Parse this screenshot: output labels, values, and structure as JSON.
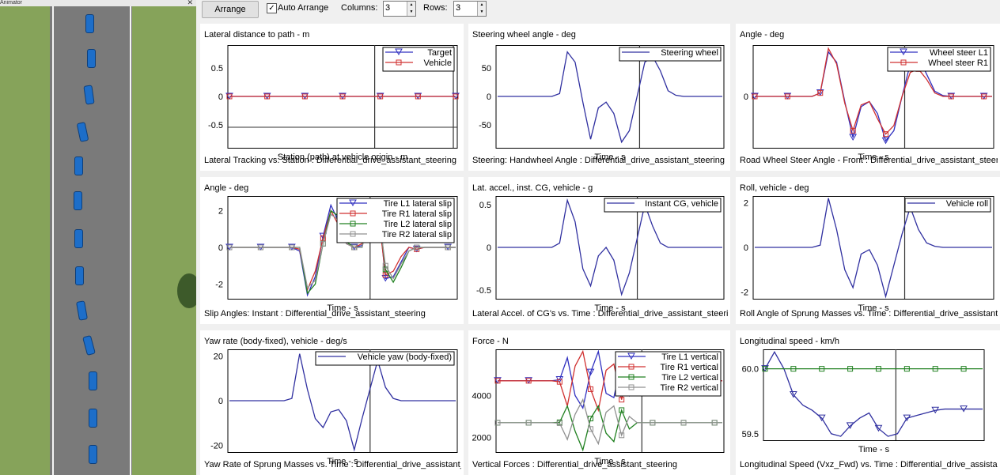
{
  "animator": {
    "title": "Animator"
  },
  "toolbar": {
    "arrange_label": "Arrange",
    "auto_arrange_checked": true,
    "auto_arrange_label": "Auto Arrange",
    "columns_label": "Columns:",
    "columns_value": "3",
    "rows_label": "Rows:",
    "rows_value": "3"
  },
  "plots": [
    {
      "title": "Lateral distance to path - m",
      "xlabel": "Station (path) at vehicle origin - m",
      "caption": "Lateral Tracking vs. Station : Differential_drive_assistant_steering"
    },
    {
      "title": "Steering wheel angle - deg",
      "xlabel": "Time - s",
      "caption": "Steering: Handwheel Angle : Differential_drive_assistant_steering"
    },
    {
      "title": "Angle - deg",
      "xlabel": "Time - s",
      "caption": "Road Wheel Steer Angle - Front : Differential_drive_assistant_steering"
    },
    {
      "title": "Angle - deg",
      "xlabel": "Time - s",
      "caption": "Slip Angles: Instant : Differential_drive_assistant_steering"
    },
    {
      "title": "Lat. accel., inst. CG, vehicle - g",
      "xlabel": "Time - s",
      "caption": "Lateral Accel. of CG's vs. Time : Differential_drive_assistant_steering"
    },
    {
      "title": "Roll, vehicle - deg",
      "xlabel": "Time - s",
      "caption": "Roll Angle of Sprung Masses vs. Time : Differential_drive_assistant_steering"
    },
    {
      "title": "Yaw rate (body-fixed), vehicle - deg/s",
      "xlabel": "Time - s",
      "caption": "Yaw Rate of Sprung Masses vs. Time : Differential_drive_assistant_steering"
    },
    {
      "title": "Force - N",
      "xlabel": "Time - s",
      "caption": "Vertical Forces : Differential_drive_assistant_steering"
    },
    {
      "title": "Longitudinal speed - km/h",
      "xlabel": "Time - s",
      "caption": "Longitudinal Speed (Vxz_Fwd) vs. Time : Differential_drive_assistant_steering"
    }
  ],
  "chart_data": [
    {
      "type": "line",
      "ylim": [
        -0.9,
        0.9
      ],
      "yticks": [
        "0.5",
        "0",
        "-0.5"
      ],
      "legend": "top-right",
      "series": [
        {
          "name": "Target",
          "color": "#3030c0",
          "marker": "triangle-down",
          "values": [
            0,
            0,
            0,
            0,
            0,
            0,
            0
          ]
        },
        {
          "name": "Vehicle",
          "color": "#d03030",
          "marker": "square",
          "values": [
            0,
            0,
            0,
            0,
            0,
            0,
            0
          ]
        }
      ]
    },
    {
      "type": "line",
      "ylim": [
        -90,
        90
      ],
      "yticks": [
        "50",
        "0",
        "-50"
      ],
      "legend": "top-right",
      "series": [
        {
          "name": "Steering wheel",
          "color": "#3030a0",
          "values": [
            0,
            0,
            0,
            0,
            0,
            0,
            0,
            0,
            5,
            78,
            60,
            -10,
            -75,
            -20,
            -10,
            -30,
            -80,
            -60,
            0,
            60,
            70,
            45,
            10,
            2,
            0,
            0,
            0,
            0,
            0,
            0
          ]
        }
      ]
    },
    {
      "type": "line",
      "ylim": [
        -3,
        3
      ],
      "yticks": [
        "0"
      ],
      "legend": "top-right",
      "series": [
        {
          "name": "Wheel steer L1",
          "color": "#3030c0",
          "marker": "triangle-down",
          "values": [
            0,
            0,
            0,
            0,
            0,
            0,
            0,
            0,
            0.2,
            2.6,
            2.0,
            -0.3,
            -2.4,
            -0.6,
            -0.3,
            -1.0,
            -2.6,
            -2.0,
            0,
            1.9,
            2.3,
            1.3,
            0.3,
            0.05,
            0,
            0,
            0,
            0,
            0,
            0
          ]
        },
        {
          "name": "Wheel steer R1",
          "color": "#d03030",
          "marker": "square",
          "values": [
            0,
            0,
            0,
            0,
            0,
            0,
            0,
            0,
            0.2,
            2.8,
            1.9,
            -0.4,
            -2.0,
            -0.5,
            -0.3,
            -1.3,
            -2.2,
            -1.7,
            0,
            1.4,
            1.6,
            1.0,
            0.2,
            0,
            0,
            0,
            0,
            0,
            0,
            0
          ]
        }
      ]
    },
    {
      "type": "line",
      "ylim": [
        -2.8,
        2.8
      ],
      "yticks": [
        "2",
        "0",
        "-2"
      ],
      "legend": "top-right",
      "series": [
        {
          "name": "Tire L1 lateral slip",
          "color": "#3030c0",
          "marker": "triangle-down",
          "values": [
            0,
            0,
            0,
            0,
            0,
            0,
            0,
            0,
            0,
            -0.2,
            -2.6,
            -1.6,
            0.6,
            2.3,
            1.4,
            0.2,
            0,
            0.1,
            2.4,
            2.6,
            -1.7,
            -1.6,
            -0.8,
            0,
            -0.1,
            0,
            0,
            0,
            0,
            0
          ]
        },
        {
          "name": "Tire R1 lateral slip",
          "color": "#d03030",
          "marker": "square",
          "values": [
            0,
            0,
            0,
            0,
            0,
            0,
            0,
            0,
            0,
            -0.1,
            -2.3,
            -1.3,
            0.5,
            2.0,
            1.2,
            0.2,
            0,
            0.2,
            2.1,
            2.2,
            -1.5,
            -1.3,
            -0.5,
            0,
            -0.1,
            0,
            0,
            0,
            0,
            0
          ]
        },
        {
          "name": "Tire L2 lateral slip",
          "color": "#208020",
          "marker": "square",
          "values": [
            0,
            0,
            0,
            0,
            0,
            0,
            0,
            0,
            0,
            0,
            -2.5,
            -2.0,
            0.2,
            2.0,
            1.7,
            0.3,
            0,
            0,
            2.0,
            2.5,
            -1.2,
            -1.9,
            -1.1,
            -0.2,
            0,
            0,
            0,
            0,
            0,
            0
          ]
        },
        {
          "name": "Tire R2 lateral slip",
          "color": "#909090",
          "marker": "square",
          "values": [
            0,
            0,
            0,
            0,
            0,
            0,
            0,
            0,
            0,
            0,
            -2.2,
            -1.8,
            0.2,
            1.8,
            1.5,
            0.2,
            0,
            0,
            1.8,
            2.2,
            -1.0,
            -1.7,
            -0.9,
            -0.2,
            0,
            0,
            0,
            0,
            0,
            0
          ]
        }
      ]
    },
    {
      "type": "line",
      "ylim": [
        -0.6,
        0.6
      ],
      "yticks": [
        "0.5",
        "0",
        "-0.5"
      ],
      "legend": "top-right",
      "series": [
        {
          "name": "Instant CG, vehicle",
          "color": "#3030a0",
          "values": [
            0,
            0,
            0,
            0,
            0,
            0,
            0,
            0,
            0.05,
            0.55,
            0.3,
            -0.25,
            -0.45,
            -0.1,
            0,
            -0.15,
            -0.55,
            -0.3,
            0.1,
            0.5,
            0.25,
            0.05,
            0,
            0,
            0,
            0,
            0,
            0,
            0,
            0
          ]
        }
      ]
    },
    {
      "type": "line",
      "ylim": [
        -2.3,
        2.3
      ],
      "yticks": [
        "2",
        "0",
        "-2"
      ],
      "legend": "top-right",
      "series": [
        {
          "name": "Vehicle roll",
          "color": "#3030a0",
          "values": [
            0,
            0,
            0,
            0,
            0,
            0,
            0,
            0,
            0.1,
            2.2,
            0.8,
            -1.0,
            -1.8,
            -0.3,
            -0.1,
            -0.8,
            -2.2,
            -0.8,
            0.6,
            1.8,
            0.8,
            0.2,
            0.05,
            0,
            0,
            0,
            0,
            0,
            0,
            0
          ]
        }
      ]
    },
    {
      "type": "line",
      "ylim": [
        -23,
        23
      ],
      "yticks": [
        "20",
        "0",
        "-20"
      ],
      "legend": "top-right",
      "series": [
        {
          "name": "Vehicle yaw (body-fixed)",
          "color": "#3030a0",
          "values": [
            0,
            0,
            0,
            0,
            0,
            0,
            0,
            0,
            1,
            21,
            5,
            -8,
            -12,
            -5,
            -4,
            -9,
            -22,
            -8,
            5,
            18,
            6,
            1,
            0,
            0,
            0,
            0,
            0,
            0,
            0,
            0
          ]
        }
      ]
    },
    {
      "type": "line",
      "ylim": [
        1300,
        6200
      ],
      "yticks": [
        "4000",
        "2000"
      ],
      "legend": "top-right",
      "series": [
        {
          "name": "Tire L1 vertical",
          "color": "#3030c0",
          "marker": "triangle-down",
          "values": [
            4700,
            4700,
            4700,
            4700,
            4700,
            4700,
            4700,
            4700,
            4750,
            5800,
            4000,
            3400,
            5100,
            6100,
            4100,
            3900,
            5600,
            4000,
            4700,
            4700,
            4700,
            4700,
            4700,
            4700,
            4700,
            4700,
            4700,
            4700,
            4700,
            4700
          ]
        },
        {
          "name": "Tire R1 vertical",
          "color": "#d03030",
          "marker": "square",
          "values": [
            4700,
            4700,
            4700,
            4700,
            4700,
            4700,
            4700,
            4700,
            4650,
            3500,
            5400,
            6100,
            4300,
            3300,
            5200,
            5500,
            3800,
            5400,
            4700,
            4700,
            4700,
            4700,
            4700,
            4700,
            4700,
            4700,
            4700,
            4700,
            4700,
            4700
          ]
        },
        {
          "name": "Tire L2 vertical",
          "color": "#208020",
          "marker": "square",
          "values": [
            2700,
            2700,
            2700,
            2700,
            2700,
            2700,
            2700,
            2700,
            2720,
            3500,
            2300,
            1400,
            2900,
            3500,
            2200,
            1800,
            3300,
            2400,
            2700,
            2700,
            2700,
            2700,
            2700,
            2700,
            2700,
            2700,
            2700,
            2700,
            2700,
            2700
          ]
        },
        {
          "name": "Tire R2 vertical",
          "color": "#909090",
          "marker": "square",
          "values": [
            2700,
            2700,
            2700,
            2700,
            2700,
            2700,
            2700,
            2700,
            2680,
            1900,
            3100,
            3800,
            2400,
            1700,
            3200,
            3500,
            2100,
            3000,
            2700,
            2700,
            2700,
            2700,
            2700,
            2700,
            2700,
            2700,
            2700,
            2700,
            2700,
            2700
          ]
        }
      ]
    },
    {
      "type": "line",
      "ylim": [
        59.45,
        60.15
      ],
      "yticks": [
        "60.0",
        "59.5"
      ],
      "legend": "none",
      "series": [
        {
          "name": "",
          "color": "#3030a0",
          "marker": "triangle-down",
          "values": [
            60.0,
            60.13,
            60.0,
            59.8,
            59.72,
            59.68,
            59.62,
            59.5,
            59.48,
            59.56,
            59.62,
            59.66,
            59.54,
            59.48,
            59.5,
            59.62,
            59.64,
            59.66,
            59.68,
            59.69,
            59.69,
            59.69,
            59.69,
            59.69
          ]
        },
        {
          "name": "",
          "color": "#208020",
          "marker": "square",
          "values": [
            60.0,
            60.0,
            60.0,
            60.0,
            60.0,
            60.0,
            60.0,
            60.0,
            60.0,
            60.0,
            60.0,
            60.0,
            60.0,
            60.0,
            60.0,
            60.0,
            60.0,
            60.0,
            60.0,
            60.0,
            60.0,
            60.0,
            60.0,
            60.0
          ]
        }
      ]
    }
  ]
}
